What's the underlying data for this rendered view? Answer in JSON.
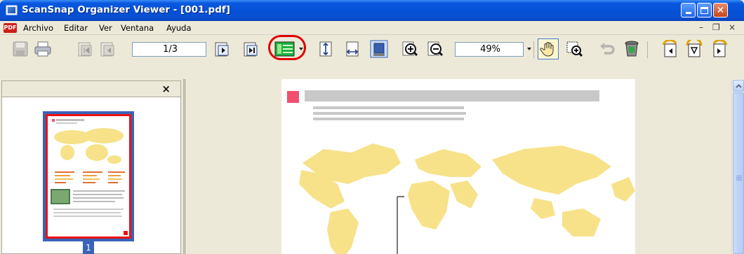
{
  "window": {
    "title": "ScanSnap Organizer Viewer - [001.pdf]"
  },
  "menu": {
    "pdf_badge": "PDF",
    "items": [
      {
        "label": "Archivo"
      },
      {
        "label": "Editar"
      },
      {
        "label": "Ver"
      },
      {
        "label": "Ventana"
      },
      {
        "label": "Ayuda"
      }
    ],
    "mdi_minimize": "–",
    "mdi_restore": "❐",
    "mdi_close": "×"
  },
  "toolbar": {
    "page_field": "1/3",
    "zoom_field": "49%"
  },
  "thumbnails": {
    "close_glyph": "×",
    "page_number": "1"
  },
  "colors": {
    "title_bar": "#0a58e0",
    "highlight_ring": "#e00000",
    "thumbnail_selection": "#3a63b8",
    "map_fill": "#f7e28a",
    "heading_marker": "#f0506e"
  }
}
